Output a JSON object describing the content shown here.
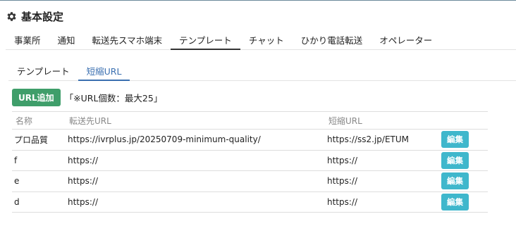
{
  "page": {
    "title": "基本設定",
    "icon": "gear-icon"
  },
  "main_tabs": [
    {
      "label": "事業所",
      "active": false
    },
    {
      "label": "通知",
      "active": false
    },
    {
      "label": "転送先スマホ端末",
      "active": false
    },
    {
      "label": "テンプレート",
      "active": true
    },
    {
      "label": "チャット",
      "active": false
    },
    {
      "label": "ひかり電話転送",
      "active": false
    },
    {
      "label": "オペレーター",
      "active": false
    }
  ],
  "sub_tabs": [
    {
      "label": "テンプレート",
      "active": false
    },
    {
      "label": "短縮URL",
      "active": true
    }
  ],
  "actions": {
    "add_label": "URL追加",
    "note": "「※URL個数：最大25」"
  },
  "table": {
    "headers": [
      "名称",
      "転送先URL",
      "短縮URL",
      ""
    ],
    "rows": [
      {
        "name": "プロ品質",
        "src": "https://ivrplus.jp/20250709-minimum-quality/",
        "short": "https://ss2.jp/ETUM",
        "action": "編集"
      },
      {
        "name": "f",
        "src": "https://",
        "short": "https://",
        "action": "編集"
      },
      {
        "name": "e",
        "src": "https://",
        "short": "https://",
        "action": "編集"
      },
      {
        "name": "d",
        "src": "https://",
        "short": "https://",
        "action": "編集"
      }
    ]
  },
  "colors": {
    "accent_blue": "#3a6fb0",
    "add_green": "#3f9e6a",
    "edit_cyan": "#3fb7cc"
  }
}
